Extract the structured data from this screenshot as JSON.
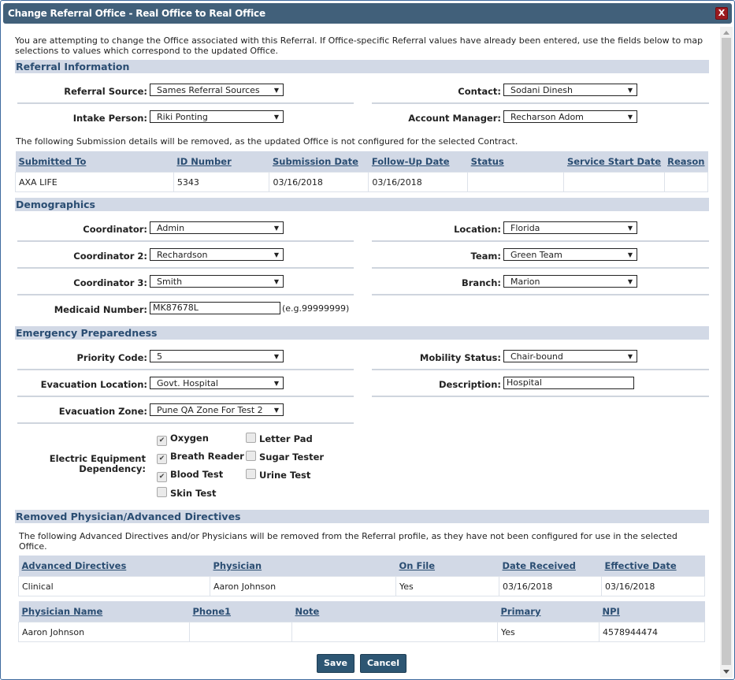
{
  "dialog": {
    "title": "Change Referral Office - Real Office to Real Office",
    "close_label": "X",
    "intro": "You are attempting to change the Office associated with this Referral. If Office-specific Referral values have already been entered, use the fields below to map selections to values which correspond to the updated Office."
  },
  "referral_info": {
    "heading": "Referral Information",
    "referral_source": {
      "label": "Referral Source:",
      "value": "Sames Referral Sources"
    },
    "contact": {
      "label": "Contact:",
      "value": "Sodani Dinesh"
    },
    "intake_person": {
      "label": "Intake Person:",
      "value": "Riki Ponting"
    },
    "account_manager": {
      "label": "Account Manager:",
      "value": "Recharson Adom"
    },
    "submission_note": "The following Submission details will be removed, as the updated Office is not configured for the selected Contract.",
    "submission_table": {
      "headers": [
        "Submitted To",
        "ID Number",
        "Submission Date",
        "Follow-Up Date",
        "Status",
        "Service Start Date",
        "Reason"
      ],
      "rows": [
        [
          "AXA LIFE",
          "5343",
          "03/16/2018",
          "03/16/2018",
          "",
          "",
          ""
        ]
      ]
    }
  },
  "demographics": {
    "heading": "Demographics",
    "coordinator": {
      "label": "Coordinator:",
      "value": "Admin"
    },
    "location": {
      "label": "Location:",
      "value": "Florida"
    },
    "coordinator2": {
      "label": "Coordinator 2:",
      "value": "Rechardson"
    },
    "team": {
      "label": "Team:",
      "value": "Green Team"
    },
    "coordinator3": {
      "label": "Coordinator 3:",
      "value": "Smith"
    },
    "branch": {
      "label": "Branch:",
      "value": "Marion"
    },
    "medicaid": {
      "label": "Medicaid Number:",
      "value": "MK87678L",
      "hint": "(e.g.99999999)"
    }
  },
  "emergency": {
    "heading": "Emergency Preparedness",
    "priority_code": {
      "label": "Priority Code:",
      "value": "5"
    },
    "mobility_status": {
      "label": "Mobility Status:",
      "value": "Chair-bound"
    },
    "evacuation_location": {
      "label": "Evacuation Location:",
      "value": "Govt. Hospital"
    },
    "description": {
      "label": "Description:",
      "value": "Hospital"
    },
    "evacuation_zone": {
      "label": "Evacuation Zone:",
      "value": "Pune QA Zone For Test 2"
    },
    "equipment": {
      "label_line1": "Electric Equipment",
      "label_line2": "Dependency:",
      "options": [
        {
          "label": "Oxygen",
          "checked": true
        },
        {
          "label": "Letter Pad",
          "checked": false
        },
        {
          "label": "Breath Reader",
          "checked": true
        },
        {
          "label": "Sugar Tester",
          "checked": false
        },
        {
          "label": "Blood Test",
          "checked": true
        },
        {
          "label": "Urine Test",
          "checked": false
        },
        {
          "label": "Skin Test",
          "checked": false
        }
      ]
    }
  },
  "removed": {
    "heading": "Removed Physician/Advanced Directives",
    "note": "The following Advanced Directives and/or Physicians will be removed from the Referral profile, as they have not been configured for use in the selected Office.",
    "directives_table": {
      "headers": [
        "Advanced Directives",
        "Physician",
        "On File",
        "Date Received",
        "Effective Date"
      ],
      "rows": [
        [
          "Clinical",
          "Aaron Johnson",
          "Yes",
          "03/16/2018",
          "03/16/2018"
        ]
      ]
    },
    "physician_table": {
      "headers": [
        "Physician Name",
        "Phone1",
        "Note",
        "Primary",
        "NPI"
      ],
      "rows": [
        [
          "Aaron Johnson",
          "",
          "",
          "Yes",
          "4578944474"
        ]
      ]
    }
  },
  "buttons": {
    "save": "Save",
    "cancel": "Cancel"
  },
  "colors": {
    "title_bar": "#41607a",
    "section_bg": "#d2d9e6",
    "section_text": "#2a4d72",
    "button_bg": "#2d5673",
    "close_bg": "#9b1a1f"
  }
}
